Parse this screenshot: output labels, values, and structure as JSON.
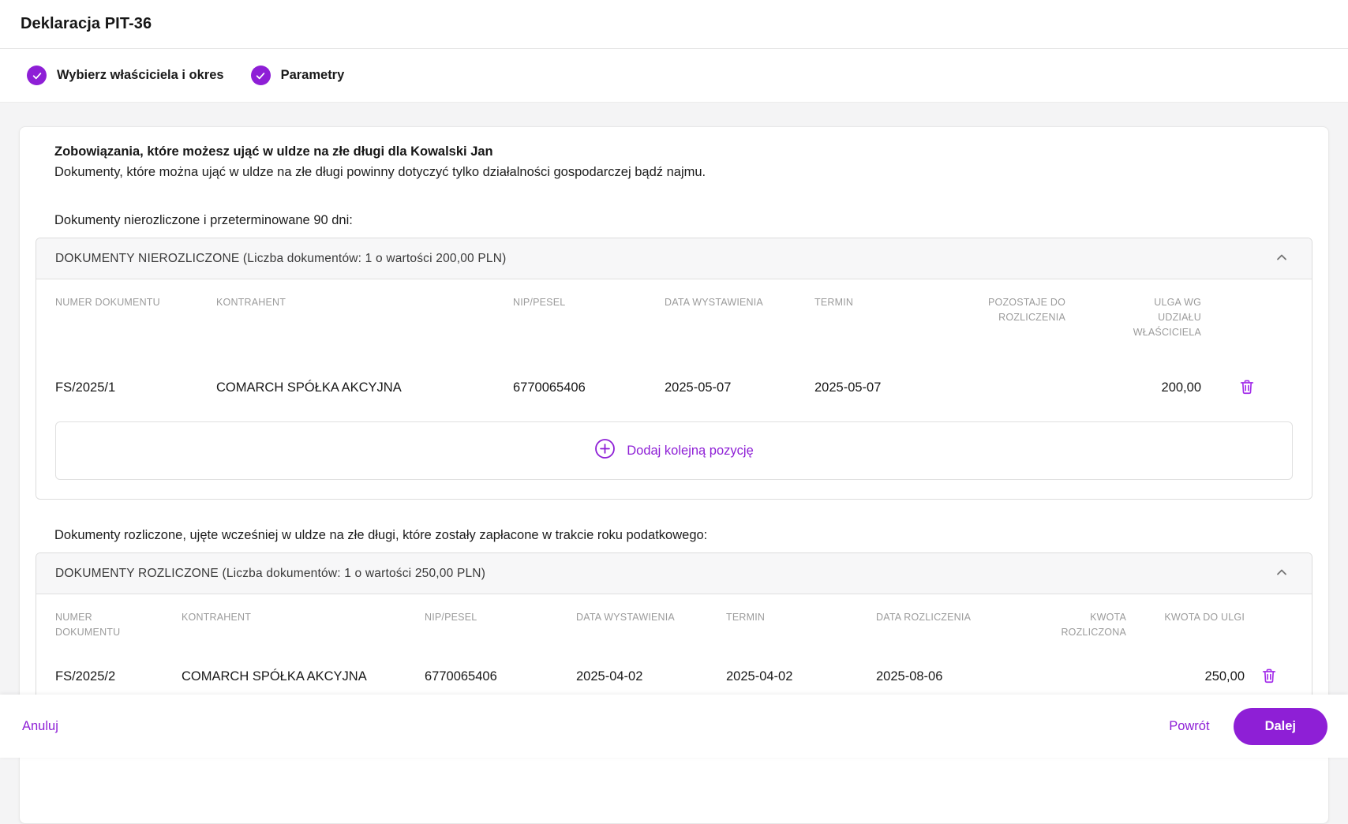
{
  "colors": {
    "accent": "#8e1fd6",
    "accent_icon": "#a22bea",
    "panel_header_bg": "#f7f7f8",
    "muted_header_text": "#9b9b9b",
    "page_bg": "#f4f4f5"
  },
  "icons": {
    "step_done": "check-icon",
    "collapse": "chevron-up-icon",
    "add": "plus-circle-icon",
    "delete": "trash-icon"
  },
  "header": {
    "title": "Deklaracja PIT-36"
  },
  "steps": [
    {
      "label": "Wybierz właściciela i okres",
      "state": "done"
    },
    {
      "label": "Parametry",
      "state": "done"
    }
  ],
  "content": {
    "heading": "Zobowiązania, które możesz ująć w uldze na złe długi dla Kowalski Jan",
    "subheading": "Dokumenty, które można ująć w uldze na złe długi powinny dotyczyć tylko działalności gospodarczej bądź najmu.",
    "section1": {
      "label": "Dokumenty nierozliczone i przeterminowane 90 dni:",
      "panel_title": "DOKUMENTY NIEROZLICZONE (Liczba dokumentów: 1 o wartości 200,00 PLN)",
      "columns": [
        "NUMER DOKUMENTU",
        "KONTRAHENT",
        "NIP/PESEL",
        "DATA WYSTAWIENIA",
        "TERMIN",
        "POZOSTAJE DO ROZLICZENIA",
        "ULGA WG UDZIAŁU WŁAŚCICIELA"
      ],
      "rows": [
        {
          "numer": "FS/2025/1",
          "kontrahent": "COMARCH SPÓŁKA AKCYJNA",
          "nip": "6770065406",
          "data_wystawienia": "2025-05-07",
          "termin": "2025-05-07",
          "pozostaje": "",
          "ulga": "200,00"
        }
      ],
      "add_label": "Dodaj kolejną pozycję"
    },
    "section2": {
      "label": "Dokumenty rozliczone, ujęte wcześniej w uldze na złe długi, które zostały zapłacone w trakcie roku podatkowego:",
      "panel_title": "DOKUMENTY ROZLICZONE (Liczba dokumentów: 1 o wartości 250,00 PLN)",
      "columns": [
        "NUMER DOKUMENTU",
        "KONTRAHENT",
        "NIP/PESEL",
        "DATA WYSTAWIENIA",
        "TERMIN",
        "DATA ROZLICZENIA",
        "KWOTA ROZLICZONA",
        "KWOTA DO ULGI"
      ],
      "rows": [
        {
          "numer": "FS/2025/2",
          "kontrahent": "COMARCH SPÓŁKA AKCYJNA",
          "nip": "6770065406",
          "data_wystawienia": "2025-04-02",
          "termin": "2025-04-02",
          "data_rozliczenia": "2025-08-06",
          "kwota_rozliczona": "",
          "kwota_do_ulgi": "250,00"
        }
      ]
    }
  },
  "footer": {
    "cancel": "Anuluj",
    "back": "Powrót",
    "next": "Dalej"
  }
}
